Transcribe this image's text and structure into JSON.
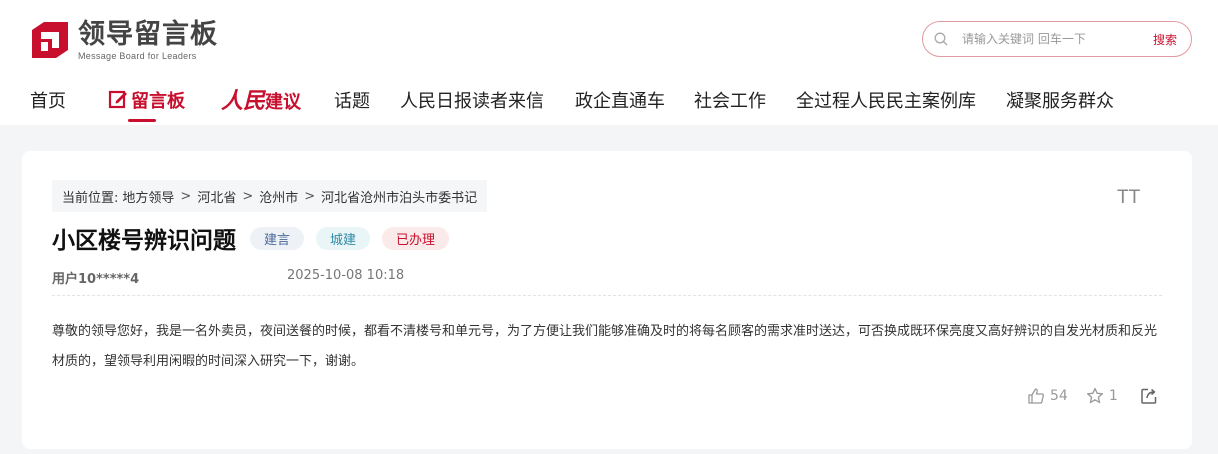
{
  "logo": {
    "title": "领导留言板",
    "subtitle": "Message Board for Leaders"
  },
  "search": {
    "placeholder": "请输入关键词 回车一下",
    "button_label": "搜索"
  },
  "nav": {
    "items": [
      {
        "label": "首页"
      },
      {
        "label": "留言板"
      },
      {
        "label_a": "人民",
        "label_b": "建议"
      },
      {
        "label": "话题"
      },
      {
        "label": "人民日报读者来信"
      },
      {
        "label": "政企直通车"
      },
      {
        "label": "社会工作"
      },
      {
        "label": "全过程人民民主案例库"
      },
      {
        "label": "凝聚服务群众"
      }
    ]
  },
  "breadcrumb": {
    "prefix": "当前位置:",
    "items": [
      "地方领导",
      "河北省",
      "沧州市",
      "河北省沧州市泊头市委书记"
    ],
    "separator": ">"
  },
  "font_size_toggle": "TT",
  "message": {
    "title": "小区楼号辨识问题",
    "tags": [
      "建言",
      "城建",
      "已办理"
    ],
    "user": "用户10*****4",
    "date": "2025-10-08 10:18",
    "content": "尊敬的领导您好，我是一名外卖员，夜间送餐的时候，都看不清楼号和单元号，为了方便让我们能够准确及时的将每名顾客的需求准时送达，可否换成既环保亮度又高好辨识的自发光材质和反光材质的，望领导利用闲暇的时间深入研究一下，谢谢。"
  },
  "actions": {
    "likes": "54",
    "favorites": "1"
  },
  "colors": {
    "brand_red": "#c8102e",
    "tag1_bg": "#eef1f6",
    "tag2_bg": "#eaf5f7",
    "tag3_bg": "#fbeaea"
  }
}
